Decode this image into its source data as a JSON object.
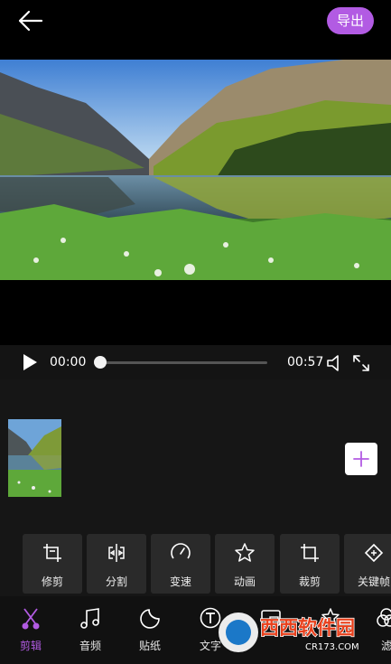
{
  "header": {
    "export_label": "导出"
  },
  "player": {
    "current_time": "00:00",
    "duration": "00:57",
    "progress": 0
  },
  "tools": [
    {
      "label": "修剪",
      "icon": "trim-icon"
    },
    {
      "label": "分割",
      "icon": "split-icon"
    },
    {
      "label": "变速",
      "icon": "speed-icon"
    },
    {
      "label": "动画",
      "icon": "animation-icon"
    },
    {
      "label": "裁剪",
      "icon": "crop-icon"
    },
    {
      "label": "关键帧",
      "icon": "keyframe-icon"
    }
  ],
  "tabs": [
    {
      "label": "剪辑",
      "icon": "scissors-icon",
      "active": true
    },
    {
      "label": "音频",
      "icon": "music-note-icon"
    },
    {
      "label": "贴纸",
      "icon": "sticker-icon"
    },
    {
      "label": "文字",
      "icon": "text-icon"
    },
    {
      "label": "",
      "icon": "pip-icon"
    },
    {
      "label": "",
      "icon": "effects-icon"
    },
    {
      "label": "滤",
      "icon": "filter-icon"
    }
  ],
  "watermark": {
    "text": "西西软件园",
    "subtext": "CR173.COM"
  },
  "colors": {
    "accent": "#b25be3",
    "panel": "#161616",
    "tool_tile": "#2a2a2a"
  }
}
